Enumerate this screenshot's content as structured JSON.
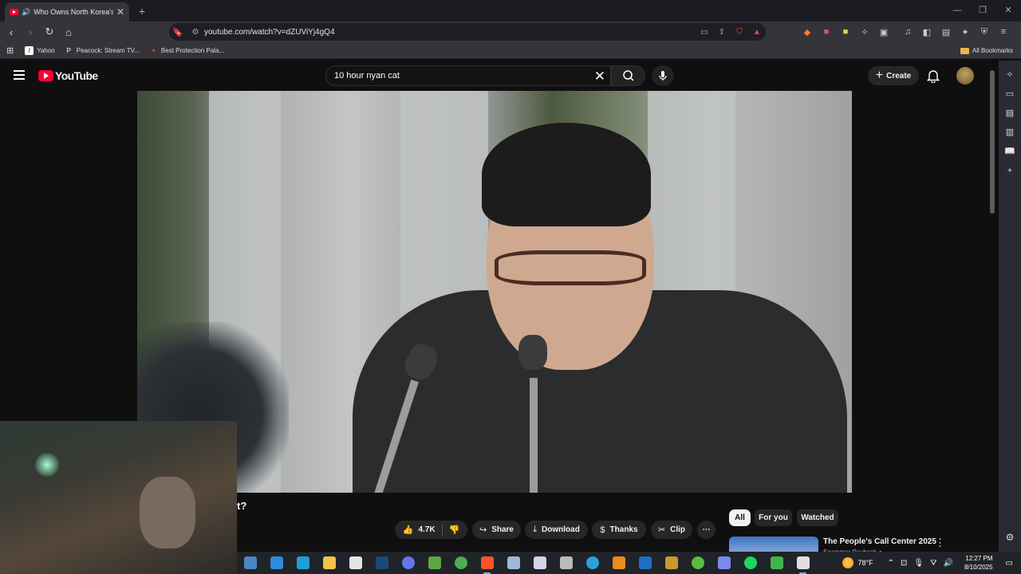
{
  "browser": {
    "tab_title": "Who Owns North Korea's Ste",
    "new_tab": "+",
    "url": "youtube.com/watch?v=dZUViYj4gQ4",
    "bookmarks": [
      {
        "label": "Yahoo",
        "icon": "Y",
        "color": "#000000"
      },
      {
        "label": "Peacock: Stream TV...",
        "icon": "P",
        "color": "#000000"
      },
      {
        "label": "Best Protection Pala...",
        "icon": "✦",
        "color": "#e0452b"
      }
    ],
    "all_bookmarks": "All Bookmarks",
    "accent": "#fb542b"
  },
  "youtube": {
    "logo_text": "YouTube",
    "search_value": "10 hour nyan cat",
    "create_label": "Create",
    "video_title_tail": "t?",
    "actions": {
      "like_count": "4.7K",
      "share": "Share",
      "download": "Download",
      "thanks": "Thanks",
      "clip": "Clip",
      "more": "⋯"
    },
    "chips": [
      "All",
      "For you",
      "Watched"
    ],
    "recommendation": {
      "title": "The People's Call Center 2025",
      "channel": "Scammer Payback ●"
    }
  },
  "taskbar": {
    "temperature": "78°F",
    "time": "12:27 PM",
    "date": "8/10/2025",
    "apps": [
      {
        "name": "notepad-app",
        "color": "#4c86c6"
      },
      {
        "name": "vscode-app",
        "color": "#2d8cdc"
      },
      {
        "name": "edge-app",
        "color": "#1ea0d8"
      },
      {
        "name": "file-explorer-app",
        "color": "#f1c34d"
      },
      {
        "name": "calculator-app",
        "color": "#e5e5e5"
      },
      {
        "name": "steam-app",
        "color": "#1b4a74"
      },
      {
        "name": "discord-app",
        "color": "#6675e8"
      },
      {
        "name": "minecraft-app",
        "color": "#5ea640"
      },
      {
        "name": "chrome-app",
        "color": "#4caf50"
      },
      {
        "name": "brave-app",
        "color": "#fb542b"
      },
      {
        "name": "notes-app",
        "color": "#9fb9d4"
      },
      {
        "name": "paint-app",
        "color": "#d8d2e8"
      },
      {
        "name": "calc2-app",
        "color": "#bbbbbb"
      },
      {
        "name": "telegram-app",
        "color": "#2ba1db"
      },
      {
        "name": "vlc-app",
        "color": "#ef8b1a"
      },
      {
        "name": "outlook-app",
        "color": "#1f6fc6"
      },
      {
        "name": "wow-app",
        "color": "#c89a2d"
      },
      {
        "name": "xbox-app",
        "color": "#5dbb40"
      },
      {
        "name": "copilot-app",
        "color": "#7c8af0"
      },
      {
        "name": "spotify-app",
        "color": "#1ed760"
      },
      {
        "name": "shield-app",
        "color": "#42b549"
      },
      {
        "name": "settings-app",
        "color": "#e0e0e0"
      }
    ]
  }
}
